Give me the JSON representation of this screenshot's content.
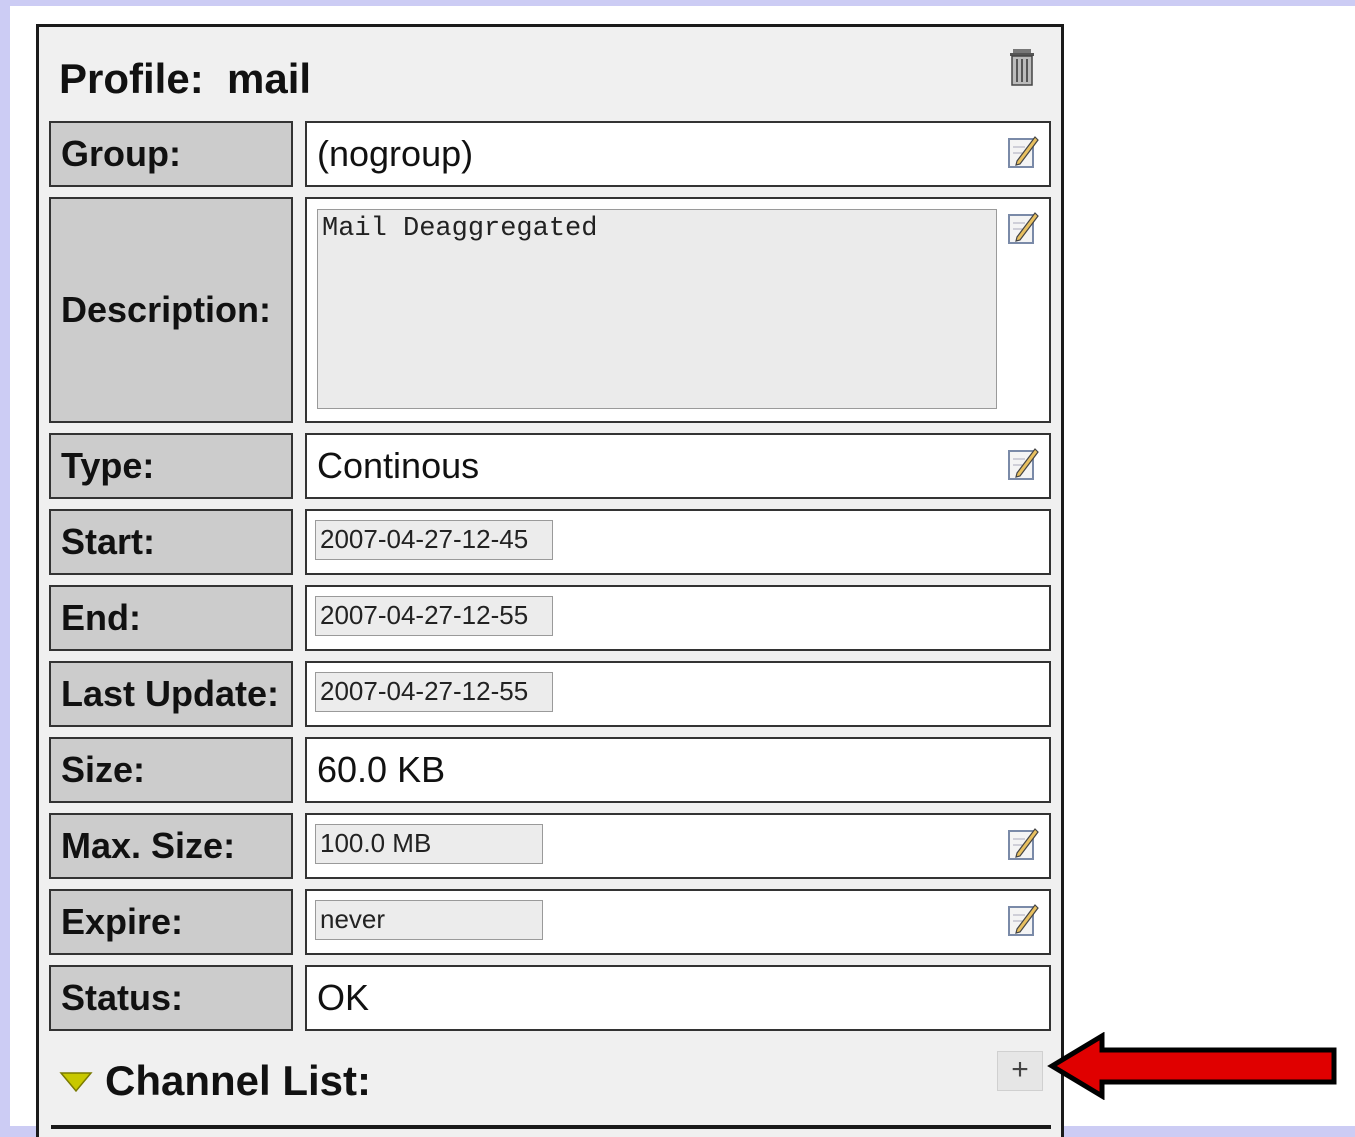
{
  "profile": {
    "label": "Profile:",
    "name": "mail"
  },
  "fields": {
    "group": {
      "label": "Group:",
      "value": "(nogroup)"
    },
    "description": {
      "label": "Description:",
      "value": "Mail Deaggregated"
    },
    "type": {
      "label": "Type:",
      "value": "Continous"
    },
    "start": {
      "label": "Start:",
      "value": "2007-04-27-12-45"
    },
    "end": {
      "label": "End:",
      "value": "2007-04-27-12-55"
    },
    "last_update": {
      "label": "Last Update:",
      "value": "2007-04-27-12-55"
    },
    "size": {
      "label": "Size:",
      "value": "60.0 KB"
    },
    "max_size": {
      "label": "Max. Size:",
      "value": "100.0 MB"
    },
    "expire": {
      "label": "Expire:",
      "value": "never"
    },
    "status": {
      "label": "Status:",
      "value": "OK"
    }
  },
  "channel_list": {
    "label": "Channel List:",
    "add_label": "+"
  },
  "icons": [
    "trash-icon",
    "edit-icon",
    "triangle-down-icon",
    "plus-icon",
    "red-arrow-icon"
  ],
  "colors": {
    "label_bg": "#cccccc",
    "panel_bg": "#f0f0f0",
    "page_bg": "#ccccf4",
    "arrow": "#e00000"
  }
}
